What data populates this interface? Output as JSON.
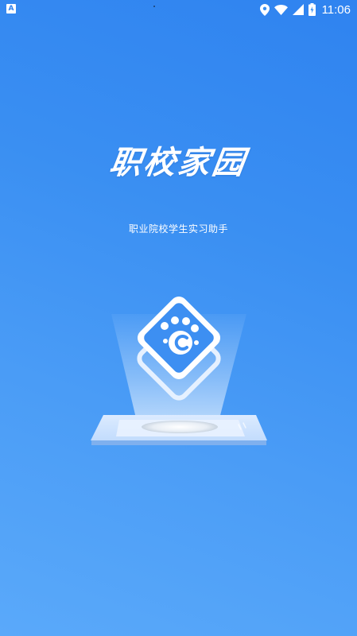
{
  "status_bar": {
    "notification_icon": "A",
    "time": "11:06",
    "icons": [
      "location-icon",
      "wifi-icon",
      "signal-icon",
      "battery-icon"
    ]
  },
  "app": {
    "title": "职校家园",
    "subtitle": "职业院校学生实习助手"
  },
  "colors": {
    "background_top": "#2f83f0",
    "background_bottom": "#5aa9fa",
    "logo_fill": "#3d8ff2",
    "text": "#ffffff"
  },
  "illustration": {
    "logo_icon": "paw-c-logo-icon",
    "platform_icon": "projector-platform-icon"
  }
}
